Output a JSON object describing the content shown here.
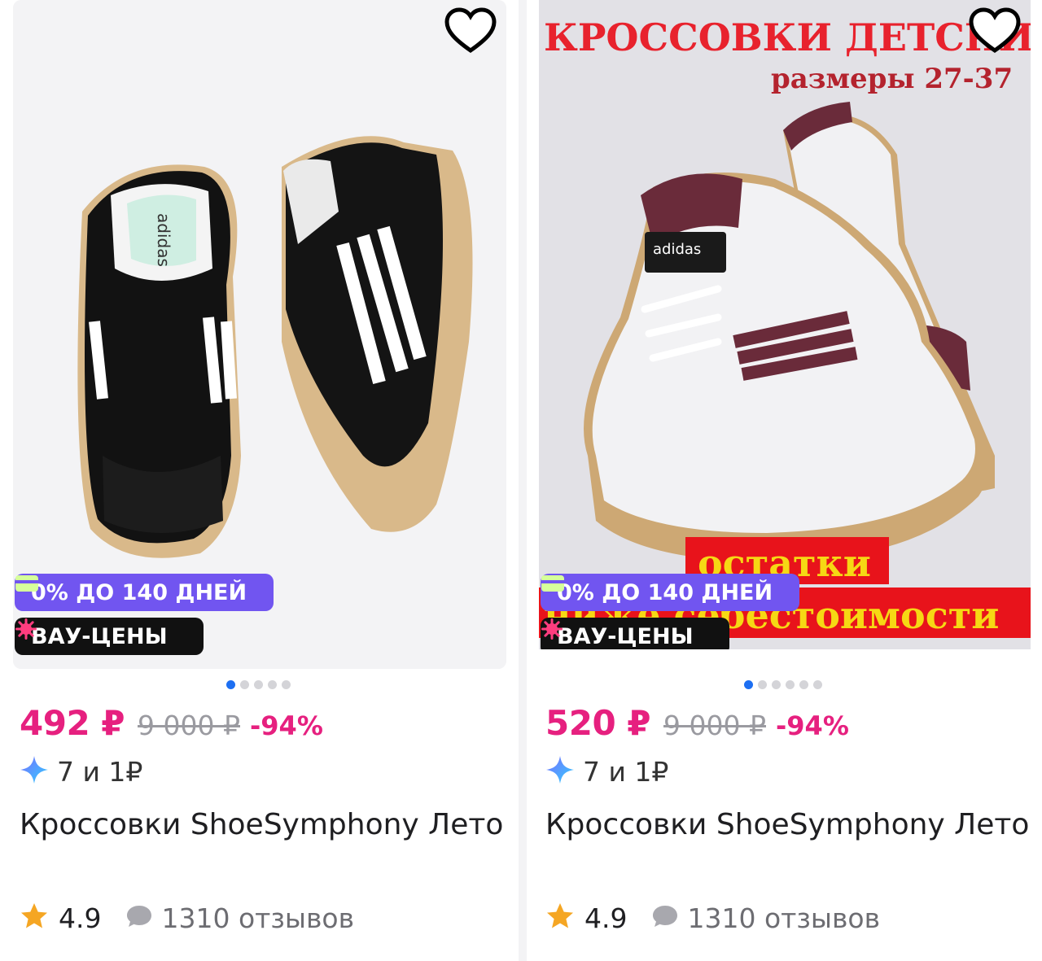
{
  "products": [
    {
      "badges": {
        "credit": "0% ДО 140 ДНЕЙ",
        "wow": "ВАУ-ЦЕНЫ"
      },
      "price": "492 ₽",
      "old_price": "9 000 ₽",
      "discount": "-94%",
      "bonus": "7 и 1₽",
      "title": "Кроссовки ShoeSymphony Лето",
      "rating": "4.9",
      "reviews": "1310 отзывов",
      "gallery": {
        "images": 5,
        "active": 1
      }
    },
    {
      "overlay": {
        "headline": "КРОССОВКИ ДЕТСКИЕ",
        "sizes": "размеры 27-37",
        "sale_line1": "остатки",
        "sale_line2": "ниже себестоимости"
      },
      "badges": {
        "credit": "0% ДО 140 ДНЕЙ",
        "wow": "ВАУ-ЦЕНЫ"
      },
      "price": "520 ₽",
      "old_price": "9 000 ₽",
      "discount": "-94%",
      "bonus": "7 и 1₽",
      "title": "Кроссовки ShoeSymphony Лето",
      "rating": "4.9",
      "reviews": "1310 отзывов",
      "gallery": {
        "images": 6,
        "active": 1
      }
    }
  ],
  "colors": {
    "price": "#e6207f",
    "credit_badge": "#7155f0",
    "wow_badge": "#111111",
    "dot_active": "#1d6ff2",
    "star": "#f5a623"
  },
  "icons": [
    "heart-icon",
    "card-icon",
    "sparkle-icon",
    "diamond-icon",
    "star-icon",
    "comment-icon"
  ]
}
